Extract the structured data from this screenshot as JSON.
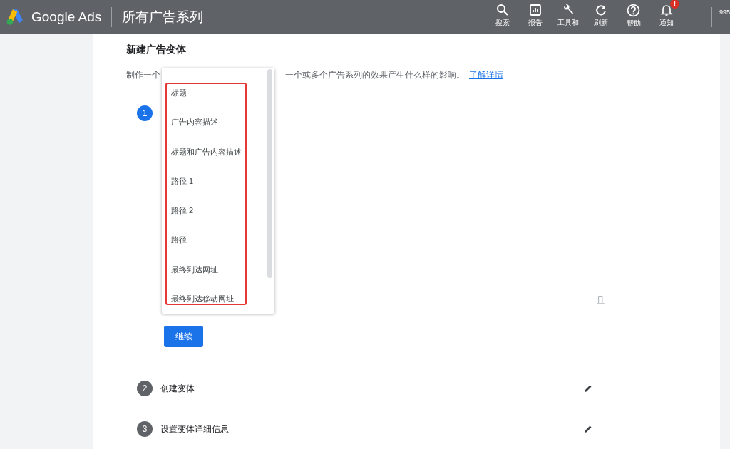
{
  "top_bar": {
    "product": "Google Ads",
    "page_title": "所有广告系列",
    "actions": [
      {
        "kind": "search",
        "label": "搜索"
      },
      {
        "kind": "report",
        "label": "报告"
      },
      {
        "kind": "tools",
        "label": "工具和"
      },
      {
        "kind": "refresh",
        "label": "刷新"
      },
      {
        "kind": "help",
        "label": "帮助"
      },
      {
        "kind": "bell",
        "label": "通知",
        "badge": "!"
      }
    ],
    "account": "995"
  },
  "panel": {
    "title": "新建广告变体",
    "description_start": "制作一个",
    "description_end": "一个或多个广告系列的效果产生什么样的影响。",
    "learn_more_link": "了解详情",
    "steps": [
      {
        "number": "1",
        "active": true
      },
      {
        "number": "2",
        "label": "创建变体",
        "active": false
      },
      {
        "number": "3",
        "label": "设置变体详细信息",
        "active": false
      }
    ],
    "hint_char": "且",
    "continue_button": "继续"
  },
  "dropdown": {
    "highlighted": true,
    "options": [
      "标题",
      "广告内容描述",
      "标题和广告内容描述",
      "路径 1",
      "路径 2",
      "路径",
      "最终到达网址",
      "最终到达移动网址"
    ]
  }
}
